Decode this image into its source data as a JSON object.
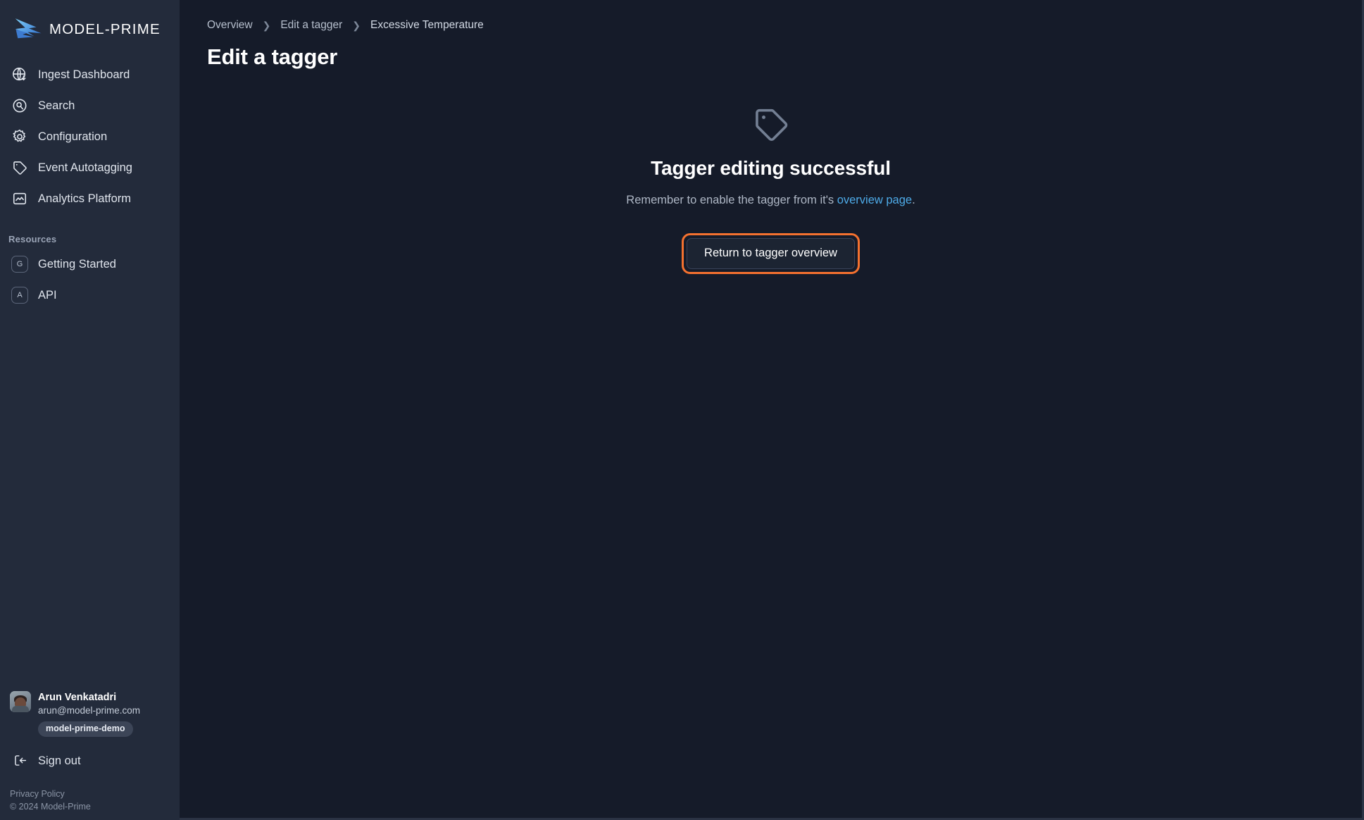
{
  "brand": {
    "name": "MODEL-PRIME",
    "logo_icon": "model-prime-swoosh-logo"
  },
  "sidebar": {
    "nav_items": [
      {
        "label": "Ingest Dashboard",
        "icon": "globe-download-icon"
      },
      {
        "label": "Search",
        "icon": "search-icon"
      },
      {
        "label": "Configuration",
        "icon": "gear-icon"
      },
      {
        "label": "Event Autotagging",
        "icon": "tag-icon"
      },
      {
        "label": "Analytics Platform",
        "icon": "image-chart-icon"
      }
    ],
    "resources_heading": "Resources",
    "resource_items": [
      {
        "label": "Getting Started",
        "badge": "G"
      },
      {
        "label": "API",
        "badge": "A"
      }
    ],
    "user": {
      "name": "Arun Venkatadri",
      "email": "arun@model-prime.com",
      "tenant": "model-prime-demo",
      "avatar_icon": "user-avatar-photo"
    },
    "sign_out": {
      "label": "Sign out",
      "icon": "sign-out-icon"
    },
    "footer": {
      "privacy_policy": "Privacy Policy",
      "copyright": "© 2024 Model-Prime"
    }
  },
  "main": {
    "breadcrumb": [
      {
        "label": "Overview",
        "current": false
      },
      {
        "label": "Edit a tagger",
        "current": false
      },
      {
        "label": "Excessive Temperature",
        "current": true
      }
    ],
    "breadcrumb_separator": "❯",
    "page_title": "Edit a tagger",
    "success": {
      "icon": "tag-icon",
      "title": "Tagger editing successful",
      "subtitle_before": "Remember to enable the tagger from it's ",
      "subtitle_link": "overview page",
      "subtitle_after": ".",
      "button_label": "Return to tagger overview"
    }
  },
  "colors": {
    "page_background": "#151b29",
    "sidebar_background": "#232b3b",
    "focus_ring_orange": "#f4712f",
    "link_blue": "#4eabe8",
    "button_background": "#1c2432",
    "tenant_badge_background": "#3c4557"
  }
}
